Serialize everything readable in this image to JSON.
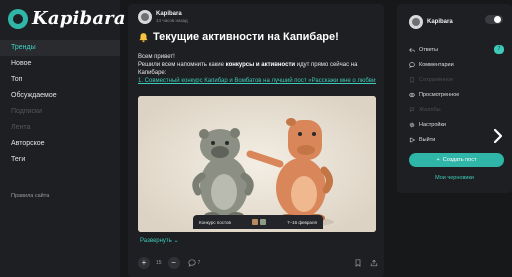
{
  "logo": {
    "text": "Kapibara"
  },
  "nav": {
    "items": [
      {
        "label": "Тренды",
        "state": "active"
      },
      {
        "label": "Новое",
        "state": "normal"
      },
      {
        "label": "Топ",
        "state": "normal"
      },
      {
        "label": "Обсуждаемое",
        "state": "normal"
      },
      {
        "label": "Подписки",
        "state": "dim"
      },
      {
        "label": "Лента",
        "state": "dim"
      },
      {
        "label": "Авторское",
        "state": "normal"
      },
      {
        "label": "Теги",
        "state": "normal"
      }
    ],
    "rules_link": "Правила сайта"
  },
  "post": {
    "author": "Kapibara",
    "time": "14 часов назад",
    "title": "Текущие активности на Капибаре!",
    "greeting": "Всем привет!",
    "line2_start": "Решили всем напомнить какие ",
    "line2_bold": "конкурсы и активности",
    "line2_end": " идут прямо сейчас на",
    "line3": "Капибаре:",
    "link": "1. Совместный конкурс Капибар и Вомбатов на лучший пост «Расскажи мне о любви»",
    "contest_label": "Конкурс постов",
    "contest_dates": "7–16 февраля",
    "expand": "Развернуть",
    "rating": "15",
    "comments": "7"
  },
  "right": {
    "username": "Kapibara",
    "menu": [
      {
        "label": "Ответы",
        "icon": "reply-icon",
        "state": "normal",
        "badge": "7"
      },
      {
        "label": "Комментарии",
        "icon": "comment-icon",
        "state": "normal"
      },
      {
        "label": "Сохранённое",
        "icon": "bookmark-icon",
        "state": "dim"
      },
      {
        "label": "Просмотренное",
        "icon": "eye-icon",
        "state": "normal"
      },
      {
        "label": "Жалобы",
        "icon": "flag-icon",
        "state": "dim"
      },
      {
        "label": "Настройки",
        "icon": "gear-icon",
        "state": "normal"
      },
      {
        "label": "Выйти",
        "icon": "logout-icon",
        "state": "normal"
      }
    ],
    "create_label": "Создать пост",
    "drafts": "Мои черновики"
  },
  "colors": {
    "accent": "#2fb6a8",
    "link": "#3ec9b9",
    "panel": "#1e1f22",
    "bg": "#17181a"
  }
}
